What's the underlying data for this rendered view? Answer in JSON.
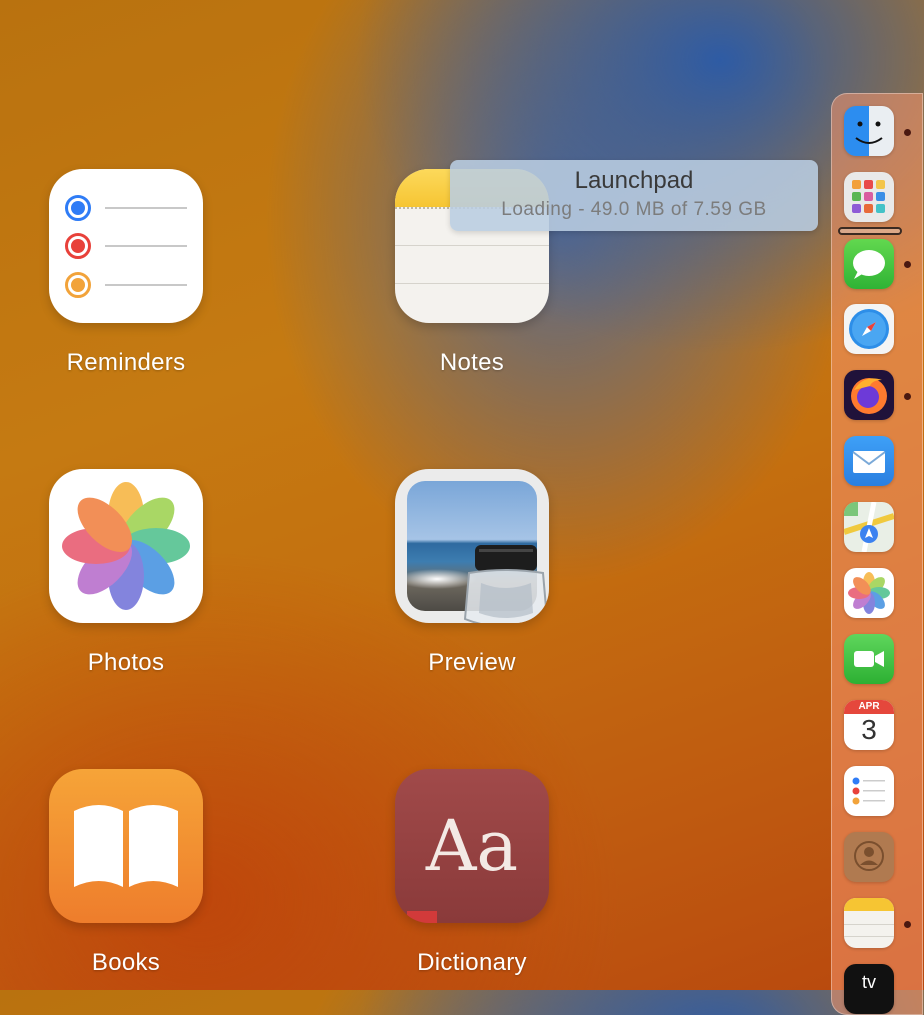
{
  "apps": [
    {
      "name": "Reminders"
    },
    {
      "name": "Notes"
    },
    {
      "name": "Photos"
    },
    {
      "name": "Preview"
    },
    {
      "name": "Books"
    },
    {
      "name": "Dictionary",
      "glyph": "Aa"
    }
  ],
  "tooltip": {
    "title": "Launchpad",
    "status": "Loading - 49.0 MB of 7.59 GB"
  },
  "dock": {
    "items": [
      {
        "icon": "finder-icon",
        "running": true
      },
      {
        "icon": "launchpad-icon",
        "running": false
      },
      {
        "icon": "messages-icon",
        "running": true
      },
      {
        "icon": "safari-icon",
        "running": false
      },
      {
        "icon": "firefox-icon",
        "running": true
      },
      {
        "icon": "mail-icon",
        "running": false
      },
      {
        "icon": "maps-icon",
        "running": false
      },
      {
        "icon": "photos-icon",
        "running": false
      },
      {
        "icon": "facetime-icon",
        "running": false
      },
      {
        "icon": "calendar-icon",
        "running": false
      },
      {
        "icon": "reminders-icon",
        "running": false
      },
      {
        "icon": "contacts-icon",
        "running": false
      },
      {
        "icon": "notes-icon",
        "running": true
      },
      {
        "icon": "apple-tv-icon",
        "running": false
      }
    ],
    "calendar": {
      "month": "APR",
      "day": "3"
    },
    "tv_label": "tv"
  },
  "colors": {
    "reminders_blue": "#2f7cf6",
    "reminders_red": "#e8413a",
    "reminders_orange": "#f2a33a",
    "notes_yellow": "#f6c533",
    "books_orange": "#ee7d2c",
    "dictionary_red": "#8a3a3a"
  }
}
